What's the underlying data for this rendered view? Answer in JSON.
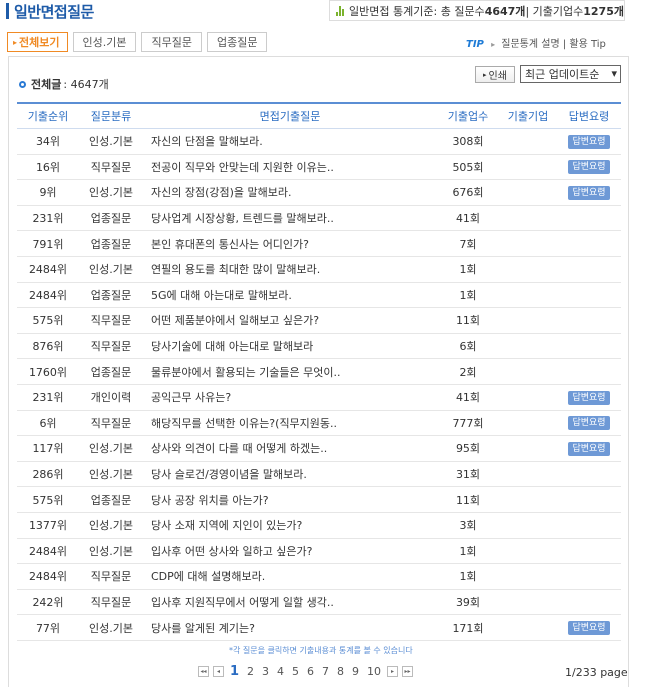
{
  "header": {
    "title": "일반면접질문",
    "stats": {
      "prefix": "일반면접 통계기준: 총 질문수 ",
      "questions": "4647개",
      "middle": " | 기출기업수 ",
      "companies": "1275개"
    }
  },
  "tabs": [
    {
      "label": "전체보기",
      "active": true
    },
    {
      "label": "인성.기본",
      "active": false
    },
    {
      "label": "직무질문",
      "active": false
    },
    {
      "label": "업종질문",
      "active": false
    }
  ],
  "tip": {
    "label": "TIP",
    "text": "질문통계 설명 | 활용 Tip"
  },
  "summary": {
    "label": "전체글",
    "count": ": 4647개"
  },
  "controls": {
    "print_label": "인쇄",
    "sort_value": "최근 업데이트순"
  },
  "table": {
    "headers": [
      "기출순위",
      "질문분류",
      "면접기출질문",
      "기출업수",
      "기출기업",
      "답변요령"
    ],
    "answer_label": "답변요령",
    "rows": [
      {
        "rank": "34위",
        "category": "인성.기본",
        "question": "자신의 단점을 말해보라.",
        "count": "308회",
        "company": "",
        "answer": true
      },
      {
        "rank": "16위",
        "category": "직무질문",
        "question": "전공이 직무와 안맞는데 지원한 이유는..",
        "count": "505회",
        "company": "",
        "answer": true
      },
      {
        "rank": "9위",
        "category": "인성.기본",
        "question": "자신의 장점(강점)을 말해보라.",
        "count": "676회",
        "company": "",
        "answer": true
      },
      {
        "rank": "231위",
        "category": "업종질문",
        "question": "당사업계 시장상황, 트렌드를 말해보라..",
        "count": "41회",
        "company": "",
        "answer": false
      },
      {
        "rank": "791위",
        "category": "업종질문",
        "question": "본인 휴대폰의 통신사는 어디인가?",
        "count": "7회",
        "company": "",
        "answer": false
      },
      {
        "rank": "2484위",
        "category": "인성.기본",
        "question": "연필의 용도를 최대한 많이 말해보라.",
        "count": "1회",
        "company": "",
        "answer": false
      },
      {
        "rank": "2484위",
        "category": "업종질문",
        "question": "5G에 대해 아는대로 말해보라.",
        "count": "1회",
        "company": "",
        "answer": false
      },
      {
        "rank": "575위",
        "category": "직무질문",
        "question": "어떤 제품분야에서 일해보고 싶은가?",
        "count": "11회",
        "company": "",
        "answer": false
      },
      {
        "rank": "876위",
        "category": "직무질문",
        "question": "당사기술에 대해 아는대로 말해보라",
        "count": "6회",
        "company": "",
        "answer": false
      },
      {
        "rank": "1760위",
        "category": "업종질문",
        "question": "물류분야에서 활용되는 기술들은 무엇이..",
        "count": "2회",
        "company": "",
        "answer": false
      },
      {
        "rank": "231위",
        "category": "개인이력",
        "question": "공익근무 사유는?",
        "count": "41회",
        "company": "",
        "answer": true
      },
      {
        "rank": "6위",
        "category": "직무질문",
        "question": "해당직무를 선택한 이유는?(직무지원동..",
        "count": "777회",
        "company": "",
        "answer": true
      },
      {
        "rank": "117위",
        "category": "인성.기본",
        "question": "상사와 의견이 다를 때 어떻게 하겠는..",
        "count": "95회",
        "company": "",
        "answer": true
      },
      {
        "rank": "286위",
        "category": "인성.기본",
        "question": "당사 슬로건/경영이념을 말해보라.",
        "count": "31회",
        "company": "",
        "answer": false
      },
      {
        "rank": "575위",
        "category": "업종질문",
        "question": "당사 공장 위치를 아는가?",
        "count": "11회",
        "company": "",
        "answer": false
      },
      {
        "rank": "1377위",
        "category": "인성.기본",
        "question": "당사 소재 지역에 지인이 있는가?",
        "count": "3회",
        "company": "",
        "answer": false
      },
      {
        "rank": "2484위",
        "category": "인성.기본",
        "question": "입사후 어떤 상사와 일하고 싶은가?",
        "count": "1회",
        "company": "",
        "answer": false
      },
      {
        "rank": "2484위",
        "category": "직무질문",
        "question": "CDP에 대해 설명해보라.",
        "count": "1회",
        "company": "",
        "answer": false
      },
      {
        "rank": "242위",
        "category": "직무질문",
        "question": "입사후 지원직무에서 어떻게 일할 생각..",
        "count": "39회",
        "company": "",
        "answer": false
      },
      {
        "rank": "77위",
        "category": "인성.기본",
        "question": "당사를 알게된 계기는?",
        "count": "171회",
        "company": "",
        "answer": true
      }
    ]
  },
  "hint": "*각 질문을 클릭하면 기출내용과 통계를 볼 수 있습니다",
  "pagination": {
    "pages": [
      "1",
      "2",
      "3",
      "4",
      "5",
      "6",
      "7",
      "8",
      "9",
      "10"
    ],
    "current": "1",
    "info": "1/233 page"
  }
}
